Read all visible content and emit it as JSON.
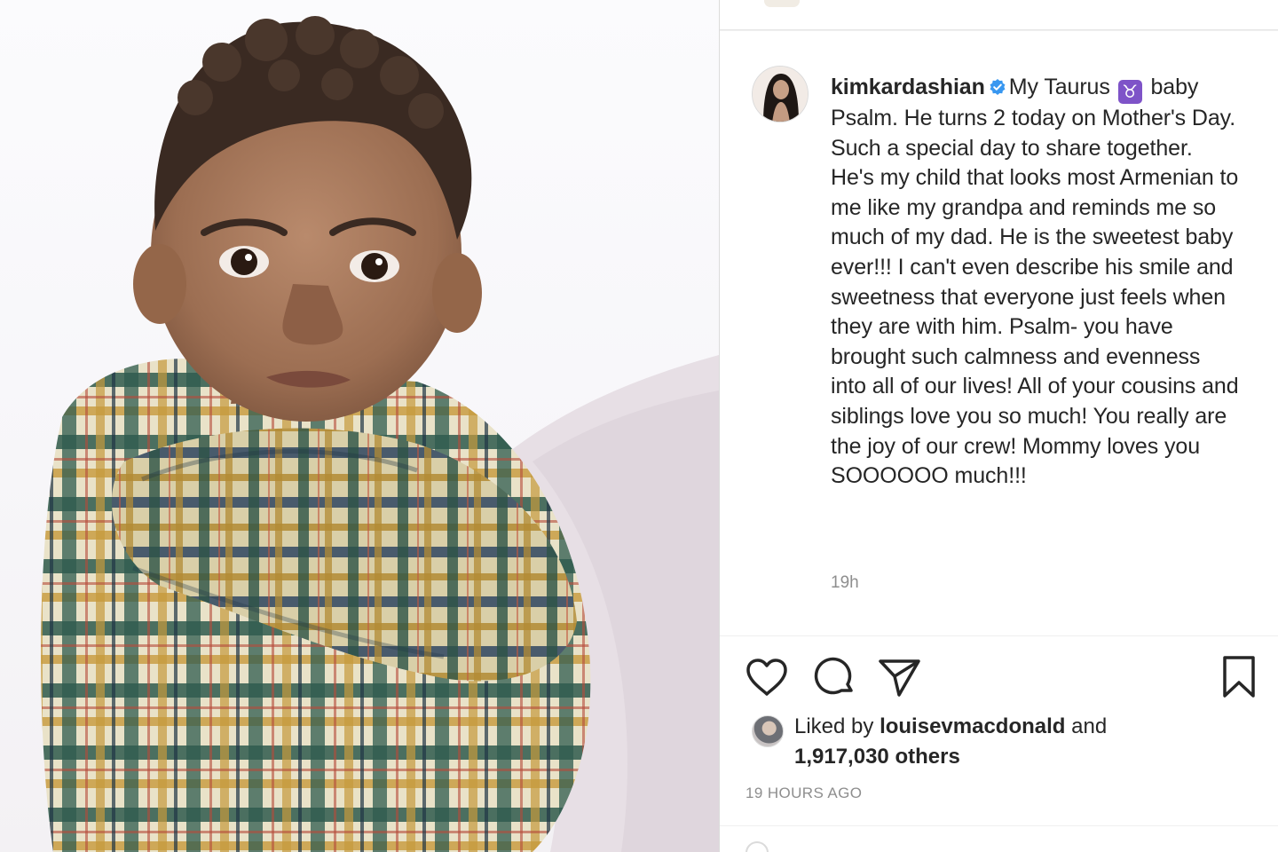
{
  "post": {
    "username": "kimkardashian",
    "caption_before_emoji": "My Taurus",
    "emoji": "♉",
    "caption_after_emoji": "baby Psalm. He turns 2 today on Mother's Day. Such a special day to share together. He's my child that looks most Armenian to me like my grandpa and reminds me so much of my dad. He is the sweetest baby ever!!! I can't even describe his smile and sweetness that everyone just feels when they are with him. Psalm- you have brought such calmness and evenness into all of our lives! All of your cousins and siblings love you so much! You really are the joy of our crew! Mommy loves you SOOOOOO much!!!",
    "relative_time": "19h",
    "liked_by_prefix": "Liked by",
    "liked_by_user": "louisevmacdonald",
    "liked_by_and": "and",
    "others": "1,917,030 others",
    "timestamp": "19 HOURS AGO"
  },
  "icons": {
    "like": "heart-icon",
    "comment": "comment-icon",
    "share": "paper-plane-icon",
    "save": "bookmark-icon",
    "verified": "verified-badge-icon"
  },
  "colors": {
    "verified_blue": "#3897f0",
    "zodiac_purple": "#7e53c8",
    "muted_text": "#8e8e8e"
  }
}
